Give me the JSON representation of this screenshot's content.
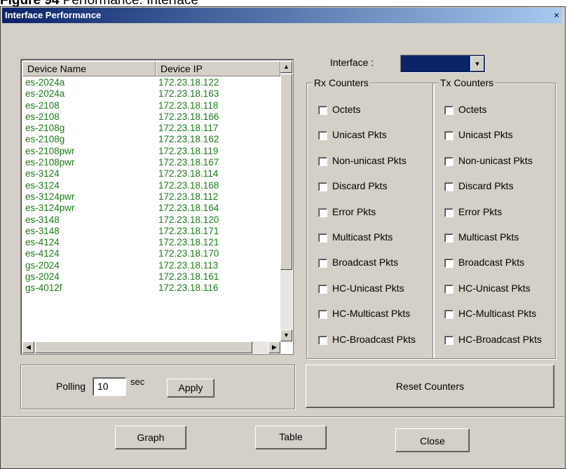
{
  "caption": {
    "bold": "Figure 94",
    "rest": "   Performance: Interface"
  },
  "window": {
    "title": "Interface Performance",
    "close_glyph": "×"
  },
  "device_list": {
    "columns": [
      "Device Name",
      "Device IP"
    ],
    "rows": [
      {
        "name": "es-2024a",
        "ip": "172.23.18.122"
      },
      {
        "name": "es-2024a",
        "ip": "172.23.18.163"
      },
      {
        "name": "es-2108",
        "ip": "172.23.18.118"
      },
      {
        "name": "es-2108",
        "ip": "172.23.18.166"
      },
      {
        "name": "es-2108g",
        "ip": "172.23.18.117"
      },
      {
        "name": "es-2108g",
        "ip": "172.23.18.162"
      },
      {
        "name": "es-2108pwr",
        "ip": "172.23.18.119"
      },
      {
        "name": "es-2108pwr",
        "ip": "172.23.18.167"
      },
      {
        "name": "es-3124",
        "ip": "172.23.18.114"
      },
      {
        "name": "es-3124",
        "ip": "172.23.18.168"
      },
      {
        "name": "es-3124pwr",
        "ip": "172.23.18.112"
      },
      {
        "name": "es-3124pwr",
        "ip": "172.23.18.164"
      },
      {
        "name": "es-3148",
        "ip": "172.23.18.120"
      },
      {
        "name": "es-3148",
        "ip": "172.23.18.171"
      },
      {
        "name": "es-4124",
        "ip": "172.23.18.121"
      },
      {
        "name": "es-4124",
        "ip": "172.23.18.170"
      },
      {
        "name": "gs-2024",
        "ip": "172.23.18.113"
      },
      {
        "name": "gs-2024",
        "ip": "172.23.18.161"
      },
      {
        "name": "gs-4012f",
        "ip": "172.23.18.116"
      }
    ],
    "text_color": "#1a7a1a"
  },
  "interface": {
    "label": "Interface :",
    "selected": ""
  },
  "rx": {
    "title": "Rx Counters",
    "items": [
      "Octets",
      "Unicast Pkts",
      "Non-unicast Pkts",
      "Discard Pkts",
      "Error Pkts",
      "Multicast Pkts",
      "Broadcast Pkts",
      "HC-Unicast Pkts",
      "HC-Multicast Pkts",
      "HC-Broadcast Pkts"
    ]
  },
  "tx": {
    "title": "Tx Counters",
    "items": [
      "Octets",
      "Unicast Pkts",
      "Non-unicast Pkts",
      "Discard Pkts",
      "Error Pkts",
      "Multicast Pkts",
      "Broadcast Pkts",
      "HC-Unicast Pkts",
      "HC-Multicast Pkts",
      "HC-Broadcast Pkts"
    ]
  },
  "polling": {
    "label": "Polling",
    "value": "10",
    "unit": "sec",
    "apply": "Apply"
  },
  "reset_label": "Reset Counters",
  "footer": {
    "graph": "Graph",
    "table": "Table",
    "close": "Close"
  },
  "colors": {
    "titlebar_start": "#0a246a",
    "titlebar_end": "#a6caf0",
    "dialog_bg": "#d4d0c8",
    "combo_fill": "#0a246a"
  }
}
